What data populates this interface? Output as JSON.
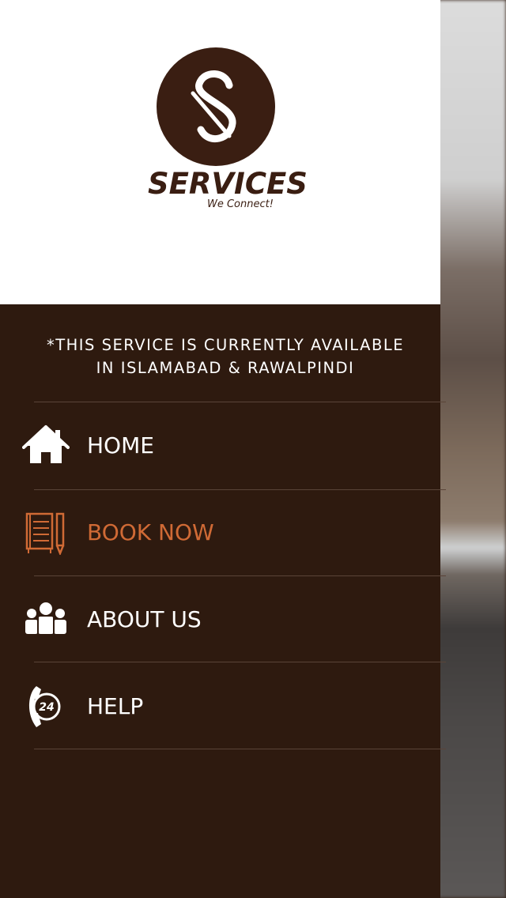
{
  "brand": {
    "name": "SERVICES",
    "tagline": "We Connect!",
    "colors": {
      "primary": "#3a1e12",
      "accent": "#d06a35",
      "panel": "#2e1a0f"
    }
  },
  "notice": {
    "line1": "*THIS SERVICE IS CURRENTLY AVAILABLE",
    "line2": "IN ISLAMABAD & RAWALPINDI"
  },
  "menu": {
    "items": [
      {
        "label": "HOME",
        "icon": "home-icon",
        "active": false
      },
      {
        "label": "BOOK NOW",
        "icon": "book-icon",
        "active": true
      },
      {
        "label": "ABOUT US",
        "icon": "people-icon",
        "active": false
      },
      {
        "label": "HELP",
        "icon": "phone-24-icon",
        "active": false
      }
    ]
  },
  "help_icon_text": "24"
}
